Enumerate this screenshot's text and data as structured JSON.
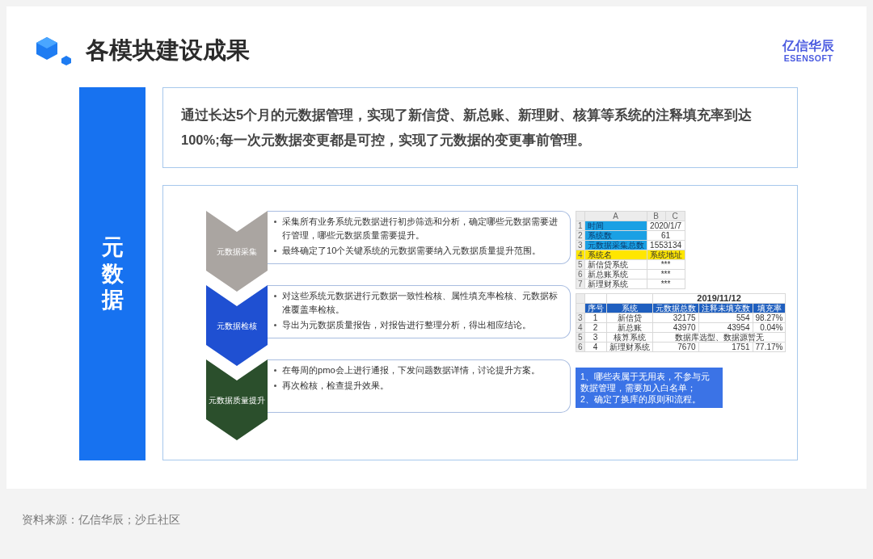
{
  "header": {
    "title": "各模块建设成果",
    "logo": {
      "name": "亿信华辰",
      "sub": "ESENSOFT"
    }
  },
  "sidebar": {
    "label": "元数据"
  },
  "summary": "通过长达5个月的元数据管理，实现了新信贷、新总账、新理财、核算等系统的注释填充率到达100%;每一次元数据变更都是可控，实现了元数据的变更事前管理。",
  "steps": [
    {
      "label": "元数据采集",
      "color": "#aaa5a1",
      "points": [
        "采集所有业务系统元数据进行初步筛选和分析，确定哪些元数据需要进行管理，哪些元数据质量需要提升。",
        "最终确定了10个关键系统的元数据需要纳入元数据质量提升范围。"
      ],
      "aside": {
        "kind": "sheet",
        "columns": [
          "A",
          "B",
          "C"
        ],
        "rows": [
          {
            "num": "1",
            "key": "时间",
            "value": "2020/1/7",
            "kind": "info"
          },
          {
            "num": "2",
            "key": "系统数",
            "value": "61",
            "kind": "info"
          },
          {
            "num": "3",
            "key": "元数据采集总数",
            "value": "1553134",
            "kind": "info"
          },
          {
            "num": "4",
            "key": "系统名",
            "value": "系统地址",
            "kind": "heading"
          },
          {
            "num": "5",
            "key": "新信贷系统",
            "value": "***",
            "kind": "plain"
          },
          {
            "num": "6",
            "key": "新总账系统",
            "value": "***",
            "kind": "plain"
          },
          {
            "num": "7",
            "key": "新理财系统",
            "value": "***",
            "kind": "plain"
          }
        ]
      }
    },
    {
      "label": "元数据检核",
      "color": "#1f50d2",
      "points": [
        "对这些系统元数据进行元数据一致性检核、属性填充率检核、元数据标准覆盖率检核。",
        "导出为元数据质量报告，对报告进行整理分析，得出相应结论。"
      ],
      "aside": {
        "kind": "report",
        "date": "2019/11/12",
        "columns": [
          "序号",
          "系统",
          "元数据总数",
          "注释未填充数",
          "填充率"
        ],
        "rows": [
          {
            "num": "3",
            "cells": [
              "1",
              "新信贷",
              "32175",
              "554",
              "98.27%"
            ]
          },
          {
            "num": "4",
            "cells": [
              "2",
              "新总账",
              "43970",
              "43954",
              "0.04%"
            ]
          },
          {
            "num": "5",
            "cells": [
              "3",
              "核算系统",
              {
                "text": "数据库选型、数据源暂无",
                "colspan": 3
              }
            ]
          },
          {
            "num": "6",
            "cells": [
              "4",
              "新理财系统",
              "7670",
              "1751",
              "77.17%"
            ]
          }
        ]
      }
    },
    {
      "label": "元数据质量提升",
      "color": "#2b4f2c",
      "points": [
        "在每周的pmo会上进行通报，下发问题数据详情，讨论提升方案。",
        "再次检核，检查提升效果。"
      ],
      "aside": {
        "kind": "note",
        "lines": [
          "1、哪些表属于无用表，不参与元数据管理，需要加入白名单；",
          "2、确定了换库的原则和流程。"
        ]
      }
    }
  ],
  "source": "资料来源：亿信华辰；沙丘社区"
}
